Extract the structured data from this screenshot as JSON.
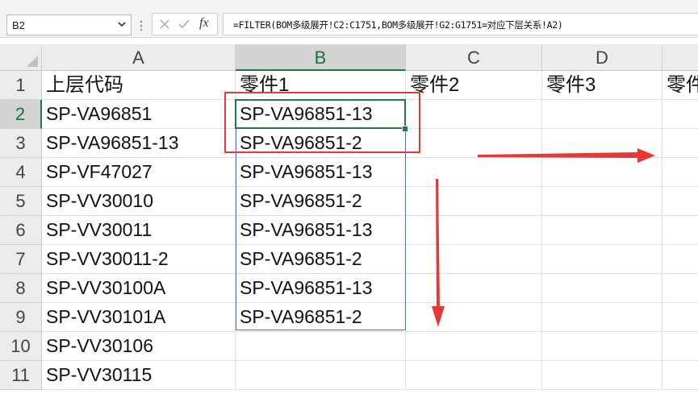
{
  "name_box": {
    "value": "B2",
    "dropdown_icon": "chevron-down-icon"
  },
  "formula_bar": {
    "cancel_icon": "close-icon",
    "enter_icon": "check-icon",
    "fx_label": "fx",
    "formula": "=FILTER(BOM多级展开!C2:C1751,BOM多级展开!G2:G1751=对应下层关系!A2)"
  },
  "columns": [
    "A",
    "B",
    "C",
    "D"
  ],
  "selected_column": "B",
  "selected_row": "2",
  "rows": [
    {
      "n": "1",
      "a": "上层代码",
      "b": "零件1",
      "c": "零件2",
      "d": "零件3",
      "e": "零件"
    },
    {
      "n": "2",
      "a": "SP-VA96851",
      "b": "SP-VA96851-13"
    },
    {
      "n": "3",
      "a": "SP-VA96851-13",
      "b": "SP-VA96851-2"
    },
    {
      "n": "4",
      "a": "SP-VF47027",
      "b": "SP-VA96851-13"
    },
    {
      "n": "5",
      "a": "SP-VV30010",
      "b": "SP-VA96851-2"
    },
    {
      "n": "6",
      "a": "SP-VV30011",
      "b": "SP-VA96851-13"
    },
    {
      "n": "7",
      "a": "SP-VV30011-2",
      "b": "SP-VA96851-2"
    },
    {
      "n": "8",
      "a": "SP-VV30100A",
      "b": "SP-VA96851-13"
    },
    {
      "n": "9",
      "a": "SP-VV30101A",
      "b": "SP-VA96851-2"
    },
    {
      "n": "10",
      "a": "SP-VV30106"
    },
    {
      "n": "11",
      "a": "SP-VV30115"
    }
  ],
  "annotations": {
    "color": "#e53935"
  }
}
